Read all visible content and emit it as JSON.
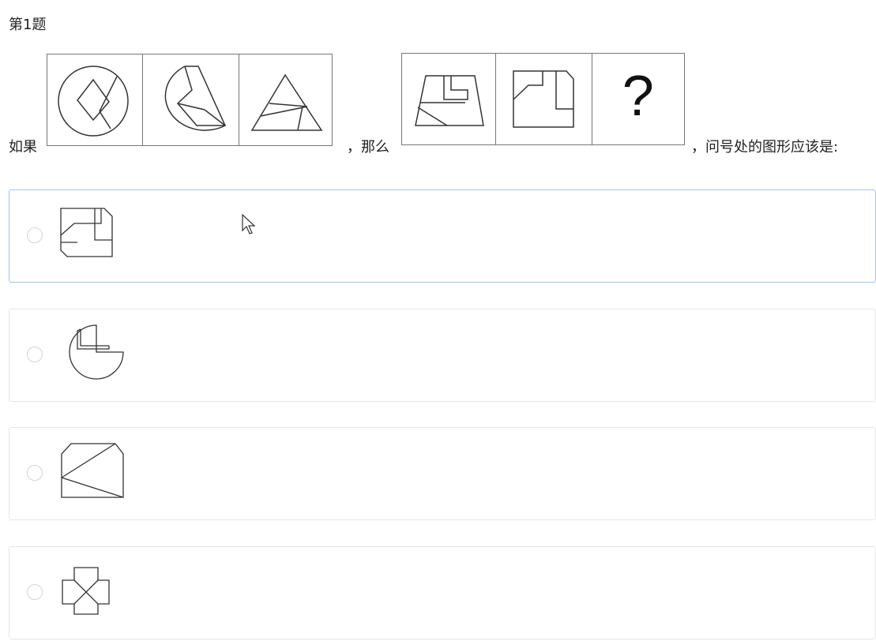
{
  "question": {
    "number_label": "第1题",
    "text_if": "如果",
    "text_then": "，那么",
    "text_ask": "，问号处的图形应该是:",
    "question_mark": "?"
  },
  "options": [
    {
      "id": "A",
      "icon": "notched-square-option-icon",
      "selected": true
    },
    {
      "id": "B",
      "icon": "circle-with-l-option-icon",
      "selected": false
    },
    {
      "id": "C",
      "icon": "pentagon-with-triangle-option-icon",
      "selected": false
    },
    {
      "id": "D",
      "icon": "cross-shape-option-icon",
      "selected": false
    }
  ],
  "colors": {
    "line": "#333333",
    "border": "#777777",
    "selected_border": "#a9bfe8"
  }
}
